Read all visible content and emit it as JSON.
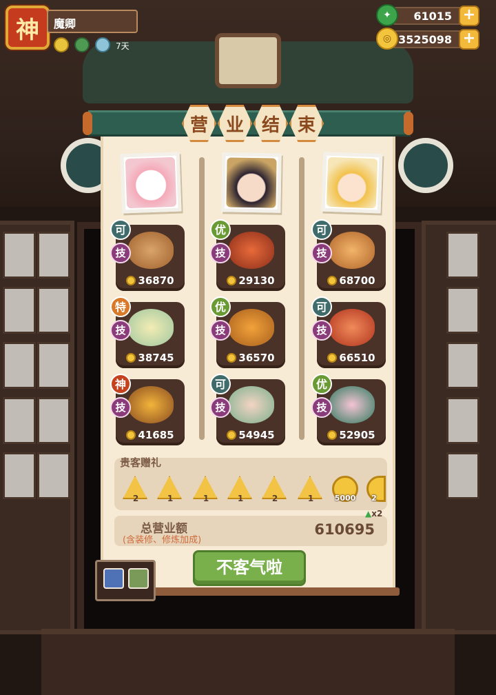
{
  "player": {
    "avatar_glyph": "神",
    "name": "魔卿",
    "buff_days": "7天"
  },
  "resources": {
    "jade": "61015",
    "coins": "3525098",
    "plus_symbol": "+"
  },
  "panel": {
    "title_chars": [
      "营",
      "业",
      "结",
      "束"
    ]
  },
  "columns": [
    {
      "dishes": [
        {
          "grade": "可",
          "skill": "技",
          "price": "36870"
        },
        {
          "grade": "特",
          "skill": "技",
          "price": "38745"
        },
        {
          "grade": "神",
          "skill": "技",
          "price": "41685"
        }
      ]
    },
    {
      "dishes": [
        {
          "grade": "优",
          "skill": "技",
          "price": "29130"
        },
        {
          "grade": "优",
          "skill": "技",
          "price": "36570"
        },
        {
          "grade": "可",
          "skill": "技",
          "price": "54945"
        }
      ]
    },
    {
      "dishes": [
        {
          "grade": "可",
          "skill": "技",
          "price": "68700"
        },
        {
          "grade": "可",
          "skill": "技",
          "price": "66510"
        },
        {
          "grade": "优",
          "skill": "技",
          "price": "52905"
        }
      ]
    }
  ],
  "gifts": {
    "title": "贵客赠礼",
    "items": [
      {
        "count": "2"
      },
      {
        "count": "1"
      },
      {
        "count": "1"
      },
      {
        "count": "1"
      },
      {
        "count": "2"
      },
      {
        "count": "1"
      }
    ],
    "coin_gift": "5000",
    "coin_gift_partial": "2"
  },
  "total": {
    "label": "总营业额",
    "note": "(含装修、修炼加成)",
    "value": "610695",
    "multiplier": "x2"
  },
  "confirm_button": "不客气啦",
  "colors": {
    "grade_ke": "#3f6b6a",
    "grade_you": "#6a9a34",
    "grade_te": "#d9792a",
    "grade_shen": "#c4421e"
  }
}
